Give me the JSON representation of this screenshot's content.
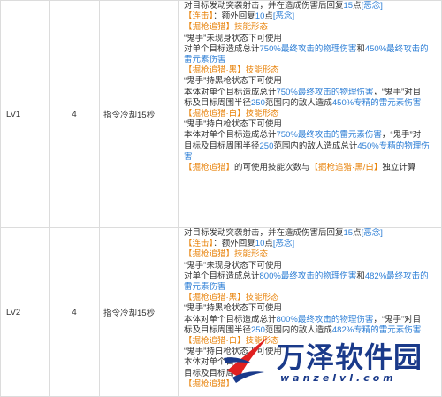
{
  "rows": [
    {
      "level": "LV1",
      "count": "4",
      "condition": "指令冷却15秒",
      "lines": [
        [
          {
            "t": "对目标发动突袭射击，并在造成伤害后回复"
          },
          {
            "t": "15",
            "c": "b"
          },
          {
            "t": "点"
          },
          {
            "t": "[恶念]",
            "c": "b"
          }
        ],
        [
          {
            "t": "【连击】",
            "c": "o"
          },
          {
            "t": "：额外回复"
          },
          {
            "t": "10",
            "c": "b"
          },
          {
            "t": "点"
          },
          {
            "t": "[恶念]",
            "c": "b"
          }
        ],
        [
          {
            "t": "【掘枪追猎】",
            "c": "o"
          },
          {
            "t": "技能形态",
            "c": "o"
          }
        ],
        [
          {
            "t": "“鬼手”未现身状态下可使用"
          }
        ],
        [
          {
            "t": "对单个目标造成总计"
          },
          {
            "t": "750%最终攻击的物理伤害",
            "c": "b"
          },
          {
            "t": "和"
          },
          {
            "t": "450%最终攻击的",
            "c": "b"
          }
        ],
        [
          {
            "t": "雷元素伤害",
            "c": "b"
          }
        ],
        [
          {
            "t": "【掘枪追猎·黑】",
            "c": "o"
          },
          {
            "t": "技能形态",
            "c": "o"
          }
        ],
        [
          {
            "t": "“鬼手”持黑枪状态下可使用"
          }
        ],
        [
          {
            "t": "本体对单个目标造成总计"
          },
          {
            "t": "750%最终攻击的物理伤害",
            "c": "b"
          },
          {
            "t": "，“鬼手”对目"
          }
        ],
        [
          {
            "t": "标及目标周围半径"
          },
          {
            "t": "250",
            "c": "b"
          },
          {
            "t": "范围内的敌人造成"
          },
          {
            "t": "450%专精的雷元素伤害",
            "c": "b"
          }
        ],
        [
          {
            "t": "【掘枪追猎·白】",
            "c": "o"
          },
          {
            "t": "技能形态",
            "c": "o"
          }
        ],
        [
          {
            "t": "“鬼手”持白枪状态下可使用"
          }
        ],
        [
          {
            "t": "本体对单个目标造成总计"
          },
          {
            "t": "750%最终攻击的雷元素伤害",
            "c": "b"
          },
          {
            "t": "，“鬼手”对"
          }
        ],
        [
          {
            "t": "目标及目标周围半径"
          },
          {
            "t": "250",
            "c": "b"
          },
          {
            "t": "范围内的敌人造成总计"
          },
          {
            "t": "450%专精的物理伤",
            "c": "b"
          }
        ],
        [
          {
            "t": "害",
            "c": "b"
          }
        ],
        [
          {
            "t": "【掘枪追猎】",
            "c": "o"
          },
          {
            "t": "的可使用技能次数与"
          },
          {
            "t": "【掘枪追猎·黑/白】",
            "c": "o"
          },
          {
            "t": "独立计算"
          }
        ]
      ]
    },
    {
      "level": "LV2",
      "count": "4",
      "condition": "指令冷却15秒",
      "lines": [
        [
          {
            "t": "对目标发动突袭射击，并在造成伤害后回复"
          },
          {
            "t": "15",
            "c": "b"
          },
          {
            "t": "点"
          },
          {
            "t": "[恶念]",
            "c": "b"
          }
        ],
        [
          {
            "t": "【连击】",
            "c": "o"
          },
          {
            "t": "：额外回复"
          },
          {
            "t": "10",
            "c": "b"
          },
          {
            "t": "点"
          },
          {
            "t": "[恶念]",
            "c": "b"
          }
        ],
        [
          {
            "t": "【掘枪追猎】",
            "c": "o"
          },
          {
            "t": "技能形态",
            "c": "o"
          }
        ],
        [
          {
            "t": "“鬼手”未现身状态下可使用"
          }
        ],
        [
          {
            "t": "对单个目标造成总计"
          },
          {
            "t": "800%最终攻击的物理伤害",
            "c": "b"
          },
          {
            "t": "和"
          },
          {
            "t": "482%最终攻击的",
            "c": "b"
          }
        ],
        [
          {
            "t": "雷元素伤害",
            "c": "b"
          }
        ],
        [
          {
            "t": "【掘枪追猎·黑】",
            "c": "o"
          },
          {
            "t": "技能形态",
            "c": "o"
          }
        ],
        [
          {
            "t": "“鬼手”持黑枪状态下可使用"
          }
        ],
        [
          {
            "t": "本体对单个目标造成总计"
          },
          {
            "t": "800%最终攻击的物理伤害",
            "c": "b"
          },
          {
            "t": "，“鬼手”对目"
          }
        ],
        [
          {
            "t": "标及目标周围半径"
          },
          {
            "t": "250",
            "c": "b"
          },
          {
            "t": "范围内的敌人造成"
          },
          {
            "t": "482%专精的雷元素伤害",
            "c": "b"
          }
        ],
        [
          {
            "t": "【掘枪追猎·白】",
            "c": "o"
          },
          {
            "t": "技能形态",
            "c": "o"
          }
        ],
        [
          {
            "t": "“鬼手”持白枪状态下可使用"
          }
        ],
        [
          {
            "t": "本体对单个目"
          }
        ],
        [
          {
            "t": "目标及目标周"
          }
        ],
        [
          {
            "t": "【掘枪追猎】",
            "c": "o"
          }
        ]
      ]
    }
  ],
  "watermark": {
    "title": "万泽软件园",
    "url": "wanzelvl.com"
  }
}
